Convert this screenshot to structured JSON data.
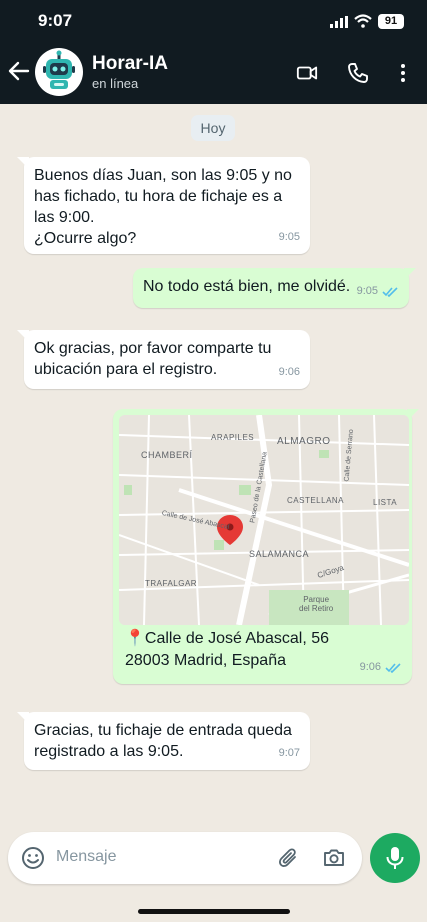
{
  "status": {
    "time": "9:07",
    "battery": "91"
  },
  "header": {
    "title": "Horar-IA",
    "subtitle": "en línea"
  },
  "day_separator": "Hoy",
  "messages": [
    {
      "text": "Buenos días Juan, son las 9:05 y no\nhas fichado, tu hora de fichaje es a\nlas 9:00.\n¿Ocurre algo?",
      "time": "9:05"
    },
    {
      "text": "No todo está bien, me olvidé.",
      "time": "9:05"
    },
    {
      "text": "Ok gracias, por favor comparte tu\nubicación para el registro.",
      "time": "9:06"
    },
    {
      "time": "9:06",
      "location": {
        "pin": "📍",
        "address": "Calle de José Abascal, 56\n28003 Madrid, España"
      },
      "map_labels": {
        "arapiles": "ARAPILES",
        "almagro": "ALMAGRO",
        "chamberi": "CHAMBERÍ",
        "castellana": "CASTELLANA",
        "lista": "LISTA",
        "jose_abascal": "Calle de José Abascal",
        "paseo": "Paseo de la Castellana",
        "serrano": "Calle de Serrano",
        "salamanca": "SALAMANCA",
        "trafalgar": "TRAFALGAR",
        "goya": "C/Goya",
        "retiro": "Parque\ndel Retiro"
      }
    },
    {
      "text": "Gracias, tu fichaje de entrada queda\nregistrado a las 9:05.",
      "time": "9:07"
    }
  ],
  "input": {
    "placeholder": "Mensaje"
  },
  "colors": {
    "header": "#111b21",
    "outgoing": "#d9fdd3",
    "incoming": "#ffffff",
    "accent": "#1daa61",
    "read_ticks": "#53bdeb"
  }
}
